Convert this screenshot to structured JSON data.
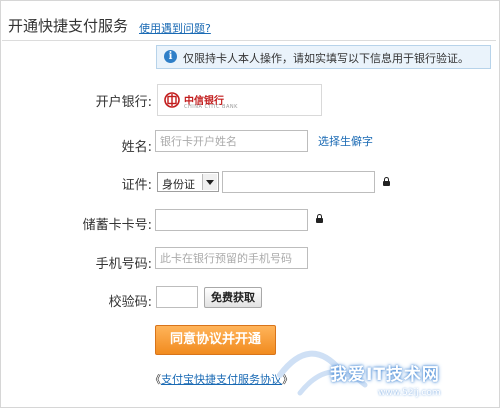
{
  "header": {
    "title": "开通快捷支付服务",
    "help_link": "使用遇到问题?"
  },
  "notice": {
    "icon": "info-icon",
    "text": "仅限持卡人本人操作，请如实填写以下信息用于银行验证。"
  },
  "form": {
    "bank": {
      "label": "开户银行:",
      "bank_name": "中信银行",
      "bank_name_en": "CHINA CITIC BANK"
    },
    "name": {
      "label": "姓名:",
      "placeholder": "银行卡开户姓名",
      "helper_link": "选择生僻字"
    },
    "id": {
      "label": "证件:",
      "type_selected": "身份证",
      "value": ""
    },
    "card": {
      "label": "储蓄卡卡号:",
      "value": ""
    },
    "phone": {
      "label": "手机号码:",
      "placeholder": "此卡在银行预留的手机号码"
    },
    "code": {
      "label": "校验码:",
      "value": "",
      "get_code_button": "免费获取"
    },
    "submit_button": "同意协议并开通",
    "agreement": {
      "open": "《",
      "link": "支付宝快捷支付服务协议",
      "close": "》"
    }
  },
  "watermark": {
    "main": "我爱IT技术网",
    "sub": "www.52ij.com"
  },
  "colors": {
    "link": "#1a6ab4",
    "primary_button": "#f18b1f",
    "notice_bg": "#eaf3fb",
    "bank_red": "#c21c1c"
  }
}
